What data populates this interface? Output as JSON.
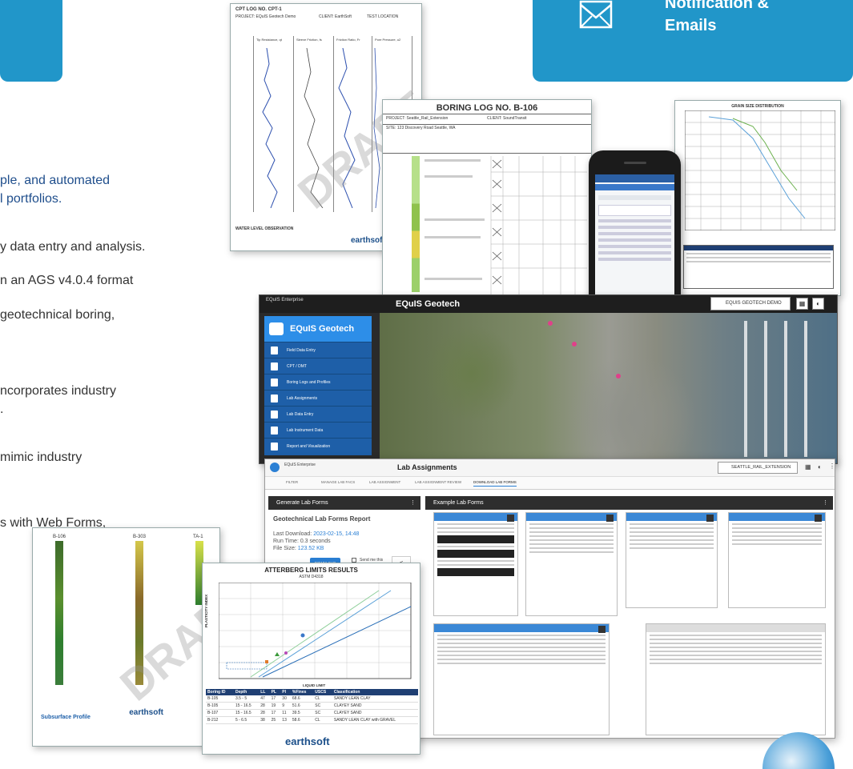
{
  "notification_card": {
    "title_line1": "Notification &",
    "title_line2": "Emails"
  },
  "bullets": [
    "ple, and automated",
    "l portfolios.",
    "y data entry and analysis.",
    "n an AGS v4.0.4 format",
    " geotechnical boring,",
    "ncorporates industry",
    ".",
    " mimic industry",
    "s with Web Forms,"
  ],
  "cpt_log": {
    "title": "CPT LOG NO. CPT-1",
    "project": "PROJECT: EQuIS Geotech Demo",
    "client": "CLIENT: EarthSoft",
    "test_location": "TEST LOCATION",
    "column_headers": [
      "Tip Resistance, qt",
      "Sleeve Friction, fs",
      "Friction Ratio, Fr",
      "Pore Pressure, u2"
    ],
    "water_level": "WATER LEVEL OBSERVATION",
    "watermark": "DRAFT",
    "brand": "earthsoft"
  },
  "boring_log": {
    "title": "BORING LOG NO. B-106",
    "project": "PROJECT: Seattle_Rail_Extension",
    "client": "CLIENT: SoundTransit",
    "site": "SITE: 123 Discovery Road Seattle, WA"
  },
  "grain_chart": {
    "title": "GRAIN SIZE DISTRIBUTION"
  },
  "app": {
    "brand": "EQuIS Enterprise",
    "title": "EQuIS Geotech",
    "user": "EQUIS GEOTECH DEMO",
    "nav_title": "EQuIS Geotech",
    "nav_items": [
      "Field Data Entry",
      "CPT / DMT",
      "Boring Logs and Profiles",
      "Lab Assignments",
      "Lab Data Entry",
      "Lab Instrument Data",
      "Report and Visualization"
    ]
  },
  "lab": {
    "brand": "EQuIS Enterprise",
    "title": "Lab Assignments",
    "user": "SEATTLE_RAIL_EXTENSION",
    "tabs": [
      "FILTER",
      "MANAGE LAB FACS",
      "LAB ASSIGNMENT",
      "LAB ASSIGNMENT REVIEW",
      "DOWNLOAD LAB FORMS"
    ],
    "generate_header": "Generate Lab Forms",
    "example_header": "Example Lab Forms",
    "report_title": "Geotechnical Lab Forms Report",
    "last_download_label": "Last Download:",
    "last_download": "2023-02-15, 14:48",
    "run_time": "Run Time: 0.3 seconds",
    "file_size_label": "File Size:",
    "file_size": "123.52 KB",
    "download_label": "DOWNLOAD",
    "send_me": "Send me this report"
  },
  "profile": {
    "boreholes": [
      "B-106",
      "B-303",
      "TA-1"
    ],
    "label": "Subsurface Profile",
    "watermark": "DRAFT",
    "brand": "earthsoft"
  },
  "atterberg": {
    "title": "ATTERBERG LIMITS RESULTS",
    "subtitle": "ASTM D4318",
    "xlabel": "LIQUID LIMIT",
    "ylabel": "PLASTICITY INDEX",
    "headers": [
      "Boring ID",
      "Depth",
      "LL",
      "PL",
      "PI",
      "%Fines",
      "USCS",
      "Classification"
    ],
    "rows": [
      [
        "B-105",
        "3.5 - 5",
        "47",
        "17",
        "30",
        "68.6",
        "CL",
        "SANDY LEAN CLAY"
      ],
      [
        "B-105",
        "15 - 16.5",
        "28",
        "19",
        "9",
        "51.6",
        "SC",
        "CLAYEY SAND"
      ],
      [
        "B-107",
        "15 - 16.5",
        "28",
        "17",
        "11",
        "39.5",
        "SC",
        "CLAYEY SAND"
      ],
      [
        "B-212",
        "5 - 6.5",
        "38",
        "25",
        "13",
        "58.6",
        "CL",
        "SANDY LEAN CLAY with GRAVEL"
      ]
    ],
    "brand": "earthsoft"
  },
  "colors": {
    "accent": "#2196c9",
    "nav": "#1e5fa8",
    "strata_green": "#8fc24d",
    "brand_green": "#2aa347"
  }
}
